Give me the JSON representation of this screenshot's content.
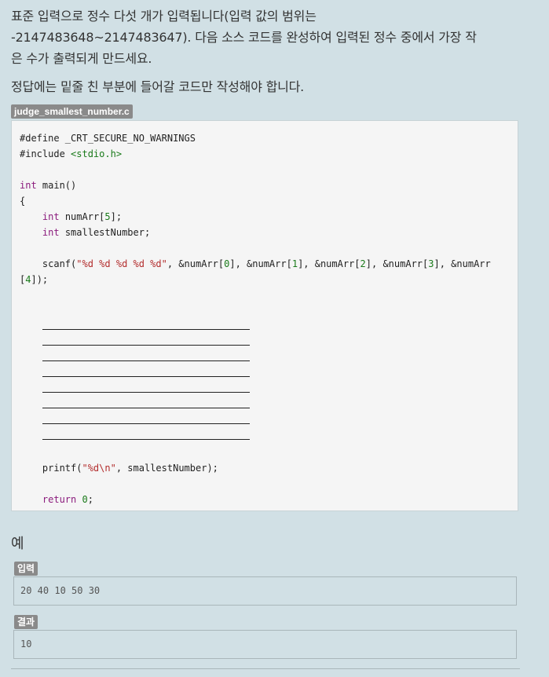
{
  "problem": {
    "description_line1": "표준 입력으로 정수 다섯 개가 입력됩니다(입력 값의 범위는",
    "description_line2": "-2147483648~2147483647). 다음 소스 코드를 완성하여 입력된 정수 중에서 가장 작",
    "description_line3": "은 수가 출력되게 만드세요.",
    "instruction": "정답에는 밑줄 친 부분에 들어갈 코드만 작성해야 합니다.",
    "file_name": "judge_smallest_number.c"
  },
  "code": {
    "line_define": "#define _CRT_SECURE_NO_WARNINGS",
    "line_include_directive": "#include ",
    "line_include_header": "<stdio.h>",
    "kw_int": "int",
    "main_sig": " main()",
    "open_brace": "{",
    "close_brace": "}",
    "decl1_rest": " numArr[",
    "decl1_num": "5",
    "decl1_end": "];",
    "decl2_rest": " smallestNumber;",
    "scanf_call": "scanf(",
    "scanf_format": "\"%d %d %d %d %d\"",
    "scanf_args_a": ", &numArr[",
    "idx0": "0",
    "scanf_args_b": "], &numArr[",
    "idx1": "1",
    "idx2": "2",
    "idx3": "3",
    "scanf_args_c": "], &numArr",
    "scanf_wrap_open": "[",
    "idx4": "4",
    "scanf_wrap_close": "]);",
    "printf_call": "printf(",
    "printf_format": "\"%d\\n\"",
    "printf_args": ", smallestNumber);",
    "kw_return": "return",
    "return_val": "0",
    "semicolon": ";"
  },
  "example": {
    "title": "예",
    "input_label": "입력",
    "input_value": "20 40 10 50 30",
    "output_label": "결과",
    "output_value": "10"
  }
}
